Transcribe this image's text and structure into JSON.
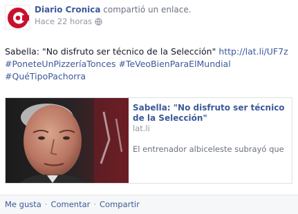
{
  "post": {
    "author": "Diario Cronica",
    "action": "compartió un enlace.",
    "timestamp": "Hace 22 horas",
    "privacy_icon": "globe-icon",
    "message": {
      "text": "Sabella: \"No disfruto ser técnico de la Selección\"",
      "url": "http://lat.li/UF7z",
      "hashtags": [
        "#PoneteUnPizzeríaTonces",
        "#TeVeoBienParaElMundial",
        "#QuéTipoPachorra"
      ]
    },
    "link_card": {
      "title": "Sabella: \"No disfruto ser técnico de la Selección\"",
      "domain": "lat.li",
      "description": "El entrenador albiceleste subrayó que"
    },
    "actions": {
      "like": "Me gusta",
      "comment": "Comentar",
      "share": "Compartir",
      "separator": "·"
    }
  },
  "colors": {
    "link": "#3b5998",
    "brand_red": "#c8102e",
    "footer_bg": "#f6f7f8",
    "muted": "#9197a3"
  }
}
